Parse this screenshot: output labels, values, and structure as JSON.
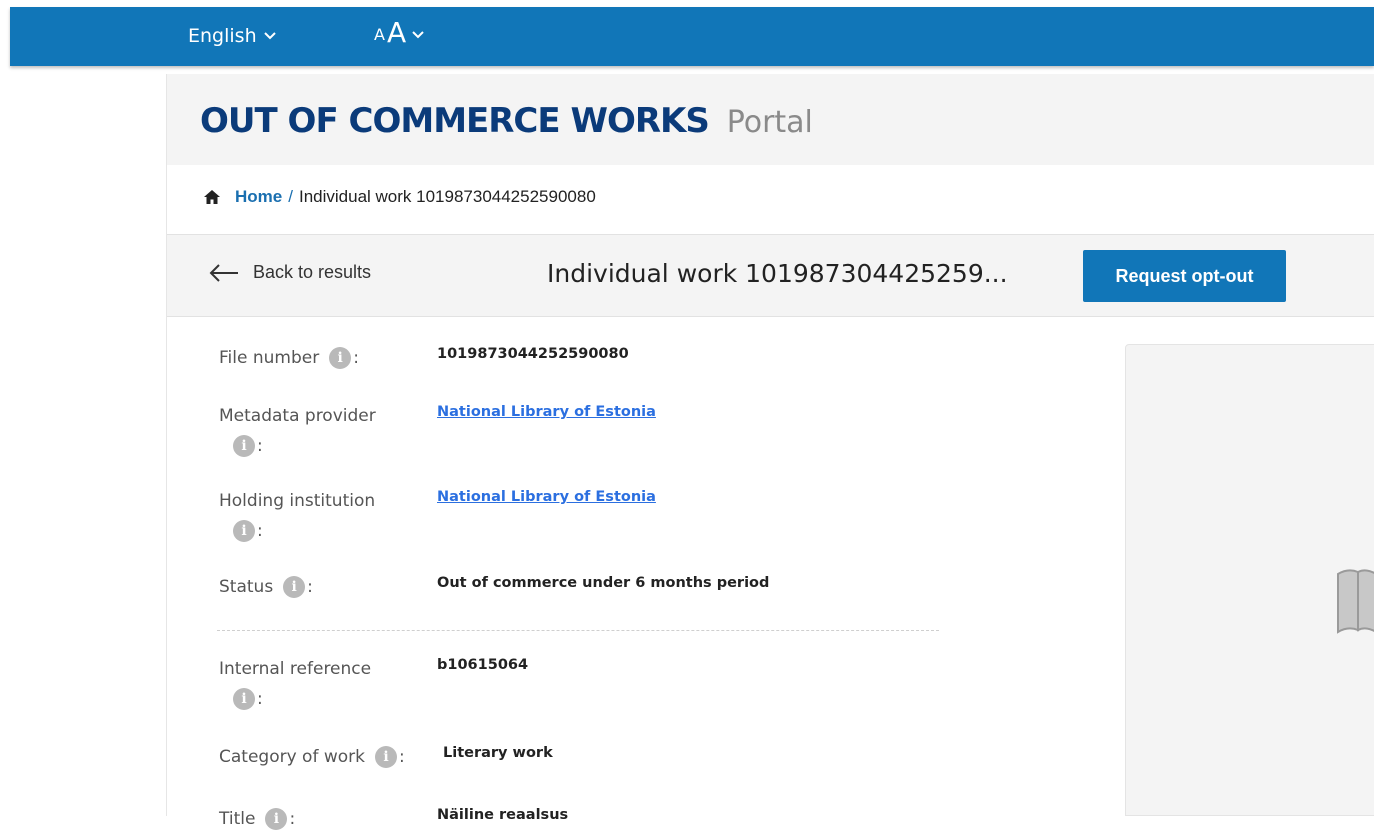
{
  "topbar": {
    "language": "English",
    "font_size_small": "A",
    "font_size_big": "A"
  },
  "header": {
    "title": "OUT OF COMMERCE WORKS",
    "subtitle": "Portal"
  },
  "breadcrumb": {
    "home": "Home",
    "separator": "/",
    "current": "Individual work 1019873044252590080"
  },
  "actions": {
    "back_label": "Back to results",
    "heading": "Individual work 101987304425259...",
    "optout_label": "Request opt-out"
  },
  "fields": {
    "file_number": {
      "label": "File number",
      "colon": ":",
      "value": "1019873044252590080"
    },
    "metadata_provider": {
      "label": "Metadata provider",
      "colon": ":",
      "value": "National Library of Estonia"
    },
    "holding_institution": {
      "label": "Holding institution",
      "colon": ":",
      "value": "National Library of Estonia"
    },
    "status": {
      "label": "Status",
      "colon": ":",
      "value": "Out of commerce under 6 months period"
    },
    "internal_reference": {
      "label": "Internal reference",
      "colon": ":",
      "value": "b10615064"
    },
    "category": {
      "label": "Category of work",
      "colon": ":",
      "value": "Literary work"
    },
    "title": {
      "label": "Title",
      "colon": ":",
      "value": "Näiline reaalsus"
    }
  },
  "icons": {
    "info": "i",
    "home": "home-icon",
    "back": "arrow-left-icon",
    "chevron": "chevron-down-icon",
    "preview": "book-icon"
  },
  "colors": {
    "brand_blue": "#1176b8",
    "title_navy": "#0b3b7a",
    "link_blue": "#2b6fe0",
    "info_grey": "#b9b9b9"
  }
}
